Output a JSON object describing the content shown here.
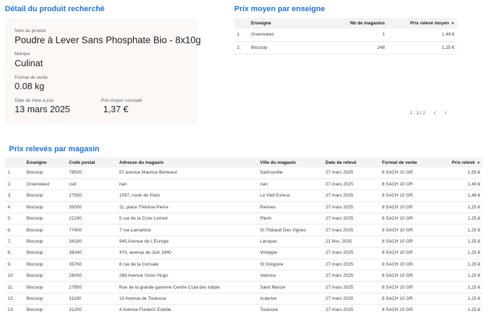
{
  "product_detail": {
    "title": "Détail du produit recherché",
    "name_label": "Nom du produit",
    "name_value": "Poudre à Lever Sans Phosphate Bio - 8x10g",
    "brand_label": "Marque",
    "brand_value": "Culinat",
    "format_label": "Format de vente",
    "format_value": "0.08 kg",
    "date_label": "Date de mise à jour",
    "date_value": "13 mars 2025",
    "avg_label": "Prix moyen constaté",
    "avg_value": "1,37 €"
  },
  "avg_by_store": {
    "title": "Prix moyen par enseigne",
    "columns": [
      "Enseigne",
      "Nb de magasins",
      "Prix relevé moyen"
    ],
    "rows": [
      [
        "1.",
        "Greenweez",
        "1",
        "1,49 €"
      ],
      [
        "2.",
        "Biocoop",
        "248",
        "1,25 €"
      ]
    ],
    "pagination": "1 - 2 / 2",
    "prev_icon": "chevron-left-icon",
    "next_icon": "chevron-right-icon"
  },
  "prices_by_store": {
    "title": "Prix relevés par magasin",
    "columns": [
      "Enseigne",
      "Code postal",
      "Adresse du magasin",
      "Ville du magasin",
      "Date de relevé",
      "Format de vente",
      "Prix relevé"
    ],
    "rows": [
      [
        "1.",
        "Biocoop",
        "78500",
        "57 avenue Maurice Berteaux",
        "Sartrouville",
        "27 mars 2025",
        "8 SACH 10 GR",
        "1,55 €"
      ],
      [
        "2.",
        "Greenweez",
        "null",
        "nan",
        "nan",
        "27 mars 2025",
        "8 SACH 10 GR",
        "1,49 €"
      ],
      [
        "3.",
        "Biocoop",
        "27930",
        "1097, route de Paris",
        "Le Vieil Evreux",
        "27 mars 2025",
        "8 SACH 10 GR",
        "1,48 €"
      ],
      [
        "4.",
        "Biocoop",
        "35000",
        "11, place Thérèse Pierre",
        "Rennes",
        "27 mars 2025",
        "8 SACH 10 GR",
        "1,25 €"
      ],
      [
        "5.",
        "Biocoop",
        "22190",
        "5 rue de la Croix Lormel",
        "Plerin",
        "27 mars 2025",
        "8 SACH 10 GR",
        "1,25 €"
      ],
      [
        "6.",
        "Biocoop",
        "77400",
        "7 rue Lamartine",
        "St Thibault Des Vignes",
        "27 mars 2025",
        "8 SACH 10 GR",
        "1,25 €"
      ],
      [
        "7.",
        "Biocoop",
        "34190",
        "945 Avenue de L'Europe",
        "Laroque",
        "21 févr. 2025",
        "8 SACH 10 GR",
        "1,25 €"
      ],
      [
        "8.",
        "Biocoop",
        "38340",
        "470, avenue de Juin 1940",
        "Voreppe",
        "27 mars 2025",
        "8 SACH 10 GR",
        "1,25 €"
      ],
      [
        "9.",
        "Biocoop",
        "35760",
        "8 rue de la Cerisaie",
        "St Gregoire",
        "27 mars 2025",
        "8 SACH 10 GR",
        "1,25 €"
      ],
      [
        "10.",
        "Biocoop",
        "26000",
        "268 Avenue Victor Hugo",
        "Valence",
        "27 mars 2025",
        "8 SACH 10 GR",
        "1,25 €"
      ],
      [
        "11.",
        "Biocoop",
        "27950",
        "Rue de la grande garenne Centre Ccial des tulipie",
        "Saint Marcel",
        "27 mars 2025",
        "8 SACH 10 GR",
        "1,25 €"
      ],
      [
        "12.",
        "Biocoop",
        "31190",
        "10 Avenue de Toulouse",
        "Auterive",
        "27 mars 2025",
        "8 SACH 10 GR",
        "1,25 €"
      ],
      [
        "13.",
        "Biocoop",
        "31200",
        "4 Avenue Frederic Estebe",
        "Toulouse",
        "27 mars 2025",
        "8 SACH 10 GR",
        "1,25 €"
      ]
    ]
  }
}
